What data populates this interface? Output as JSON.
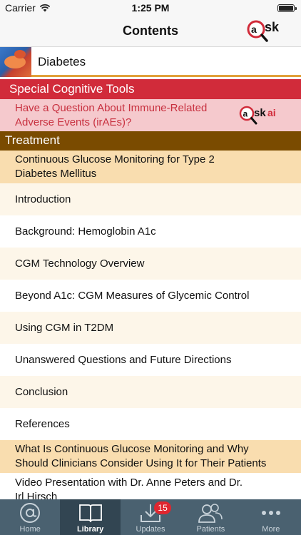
{
  "status_bar": {
    "carrier": "Carrier",
    "time": "1:25 PM"
  },
  "nav": {
    "title": "Contents",
    "logo_text": "sk"
  },
  "book": {
    "title": "Diabetes"
  },
  "special_section": {
    "title": "Special Cognitive Tools"
  },
  "ask_item": {
    "line1": "Have a Question About Immune-Related",
    "line2": "Adverse Events (irAEs)?",
    "logo_text": "sk",
    "logo_suffix": "ai"
  },
  "treatment_section": {
    "title": "Treatment"
  },
  "items": [
    {
      "line1": "Continuous Glucose Monitoring for Type 2",
      "line2": "Diabetes Mellitus",
      "style": "gold"
    },
    {
      "line1": "Introduction",
      "line2": "",
      "style": "cream"
    },
    {
      "line1": "Background: Hemoglobin A1c",
      "line2": "",
      "style": "white"
    },
    {
      "line1": "CGM Technology Overview",
      "line2": "",
      "style": "cream"
    },
    {
      "line1": "Beyond A1c: CGM Measures of Glycemic Control",
      "line2": "",
      "style": "white"
    },
    {
      "line1": "Using CGM in T2DM",
      "line2": "",
      "style": "cream"
    },
    {
      "line1": "Unanswered Questions and Future Directions",
      "line2": "",
      "style": "white"
    },
    {
      "line1": "Conclusion",
      "line2": "",
      "style": "cream"
    },
    {
      "line1": "References",
      "line2": "",
      "style": "white"
    },
    {
      "line1": "What Is Continuous Glucose Monitoring and Why",
      "line2": "Should Clinicians Consider Using It for Their Patients",
      "style": "gold"
    },
    {
      "line1": "Video Presentation with Dr. Anne Peters and Dr.",
      "line2": "Irl Hirsch",
      "style": "white"
    }
  ],
  "tabs": [
    {
      "label": "Home",
      "icon": "at-icon"
    },
    {
      "label": "Library",
      "icon": "book-icon"
    },
    {
      "label": "Updates",
      "icon": "download-icon",
      "badge": "15"
    },
    {
      "label": "Patients",
      "icon": "patients-icon"
    },
    {
      "label": "More",
      "icon": "more-icon"
    }
  ],
  "colors": {
    "special_section": "#d12b3a",
    "ask_row": "#f5c9cd",
    "treatment_section": "#7a4b00",
    "row_gold": "#f9ddaf",
    "row_cream": "#fdf6e9",
    "tab_bar": "#4a6170",
    "tab_active": "#324552",
    "badge": "#e0262f"
  }
}
